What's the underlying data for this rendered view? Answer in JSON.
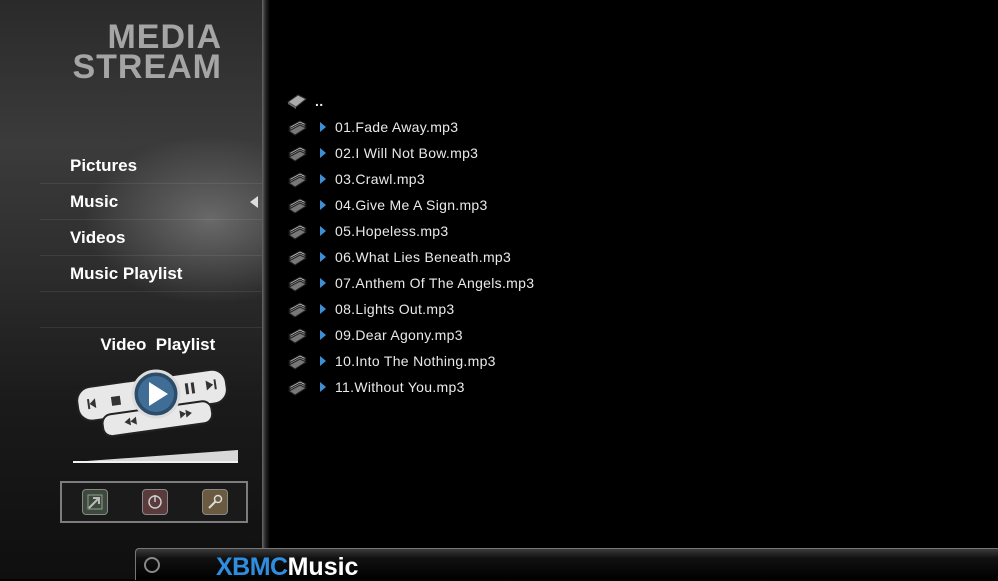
{
  "logo": {
    "line1": "MEDIA",
    "line2": "STREAM"
  },
  "menu": {
    "items": [
      {
        "label": "Pictures",
        "selected": false
      },
      {
        "label": "Music",
        "selected": true
      },
      {
        "label": "Videos",
        "selected": false
      },
      {
        "label": "Music Playlist",
        "selected": false
      },
      {
        "label": "Video  Playlist",
        "selected": false
      }
    ]
  },
  "file_list": {
    "parent": "..",
    "files": [
      "01.Fade Away.mp3",
      "02.I Will Not Bow.mp3",
      "03.Crawl.mp3",
      "04.Give Me A Sign.mp3",
      "05.Hopeless.mp3",
      "06.What Lies Beneath.mp3",
      "07.Anthem Of The Angels.mp3",
      "08.Lights Out.mp3",
      "09.Dear Agony.mp3",
      "10.Into The Nothing.mp3",
      "11.Without You.mp3"
    ]
  },
  "bottom_bar": {
    "brand": "XBMC",
    "section": "Music"
  },
  "colors": {
    "accent": "#2e8ee0",
    "arrow": "#3d8fd6",
    "logo": "#a5a5a5"
  },
  "icons": {
    "file": "music-file-icon",
    "parent": "parent-folder-icon",
    "remote": "remote-control-icon",
    "tools": [
      "exit-icon",
      "power-icon",
      "settings-key-icon"
    ]
  }
}
